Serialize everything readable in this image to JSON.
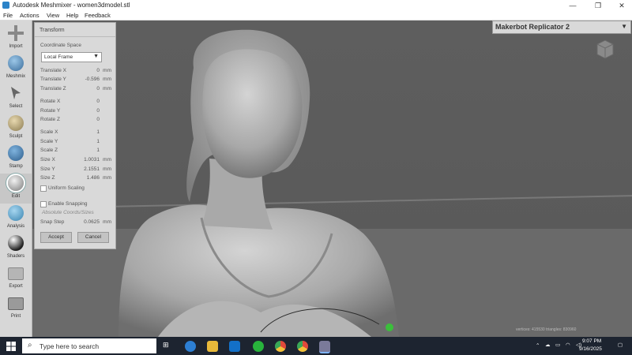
{
  "window": {
    "title": "Autodesk Meshmixer - women3dmodel.stl",
    "controls": [
      "—",
      "❐",
      "✕"
    ]
  },
  "menu": [
    "File",
    "Actions",
    "View",
    "Help",
    "Feedback"
  ],
  "toolbar": [
    {
      "label": "Import",
      "icon": "plus-icon"
    },
    {
      "label": "Meshmix",
      "icon": "meshmix-icon"
    },
    {
      "label": "Select",
      "icon": "select-arrow-icon"
    },
    {
      "label": "Sculpt",
      "icon": "sculpt-brush-icon"
    },
    {
      "label": "Stamp",
      "icon": "stamp-icon"
    },
    {
      "label": "Edit",
      "icon": "edit-sphere-icon"
    },
    {
      "label": "Analysis",
      "icon": "analysis-icon"
    },
    {
      "label": "Shaders",
      "icon": "shader-ball-icon"
    },
    {
      "label": "Export",
      "icon": "export-folder-icon"
    },
    {
      "label": "Print",
      "icon": "print-icon"
    }
  ],
  "panel": {
    "title": "Transform",
    "coordinate_space_label": "Coordinate Space",
    "coordinate_space_value": "Local Frame",
    "rows": [
      {
        "label": "Translate X",
        "value": "0",
        "unit": "mm"
      },
      {
        "label": "Translate Y",
        "value": "-0.596",
        "unit": "mm"
      },
      {
        "label": "Translate Z",
        "value": "0",
        "unit": "mm"
      },
      {
        "label": "Rotate X",
        "value": "0",
        "unit": ""
      },
      {
        "label": "Rotate Y",
        "value": "0",
        "unit": ""
      },
      {
        "label": "Rotate Z",
        "value": "0",
        "unit": ""
      },
      {
        "label": "Scale X",
        "value": "1",
        "unit": ""
      },
      {
        "label": "Scale Y",
        "value": "1",
        "unit": ""
      },
      {
        "label": "Scale Z",
        "value": "1",
        "unit": ""
      },
      {
        "label": "Size X",
        "value": "1.0031",
        "unit": "mm"
      },
      {
        "label": "Size Y",
        "value": "2.1551",
        "unit": "mm"
      },
      {
        "label": "Size Z",
        "value": "1.486",
        "unit": "mm"
      }
    ],
    "uniform_scaling": "Uniform Scaling",
    "enable_snapping": "Enable Snapping",
    "absolute_coords": "Absolute Coords/Sizes",
    "snap_step_label": "Snap Step",
    "snap_step_value": "0.0625",
    "snap_step_unit": "mm",
    "accept": "Accept",
    "cancel": "Cancel"
  },
  "printer": {
    "name": "Makerbot Replicator 2"
  },
  "status": "vertices: 415530 triangles: 830960",
  "taskbar": {
    "search_placeholder": "Type here to search",
    "time": "9:07 PM",
    "date": "9/16/2025"
  },
  "colors": {
    "viewport": "#5a5a5a",
    "panel": "#d9d9d9",
    "taskbar": "#1d2430",
    "accent": "#2c83c8"
  }
}
